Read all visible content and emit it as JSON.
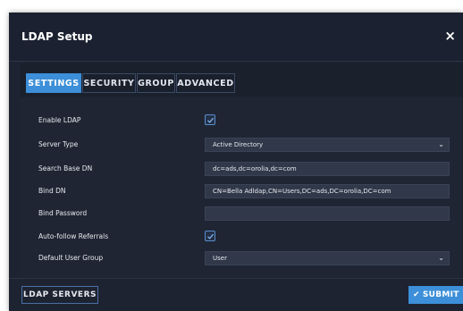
{
  "dialog": {
    "title": "LDAP Setup",
    "close_symbol": "×"
  },
  "tabs": [
    {
      "label": "SETTINGS",
      "active": true
    },
    {
      "label": "SECURITY",
      "active": false
    },
    {
      "label": "GROUP",
      "active": false
    },
    {
      "label": "ADVANCED",
      "active": false
    }
  ],
  "form": {
    "enable_ldap": {
      "label": "Enable LDAP",
      "checked": true
    },
    "server_type": {
      "label": "Server Type",
      "value": "Active Directory"
    },
    "search_base_dn": {
      "label": "Search Base DN",
      "value": "dc=ads,dc=orolia,dc=com"
    },
    "bind_dn": {
      "label": "Bind DN",
      "value": "CN=Bella Adldap,CN=Users,DC=ads,DC=orolia,DC=com"
    },
    "bind_password": {
      "label": "Bind Password",
      "value": ""
    },
    "auto_follow_referrals": {
      "label": "Auto-follow Referrals",
      "checked": true
    },
    "default_user_group": {
      "label": "Default User Group",
      "value": "User"
    }
  },
  "footer": {
    "ldap_servers_label": "LDAP SERVERS",
    "submit_label": "SUBMIT"
  },
  "colors": {
    "accent": "#3c8fd8",
    "dialog_bg": "#1d2331",
    "field_bg": "#303849"
  },
  "icons": {
    "close": "close-icon",
    "checkbox": "checkmark-icon",
    "dropdown": "chevron-down-icon",
    "submit": "check-icon"
  }
}
